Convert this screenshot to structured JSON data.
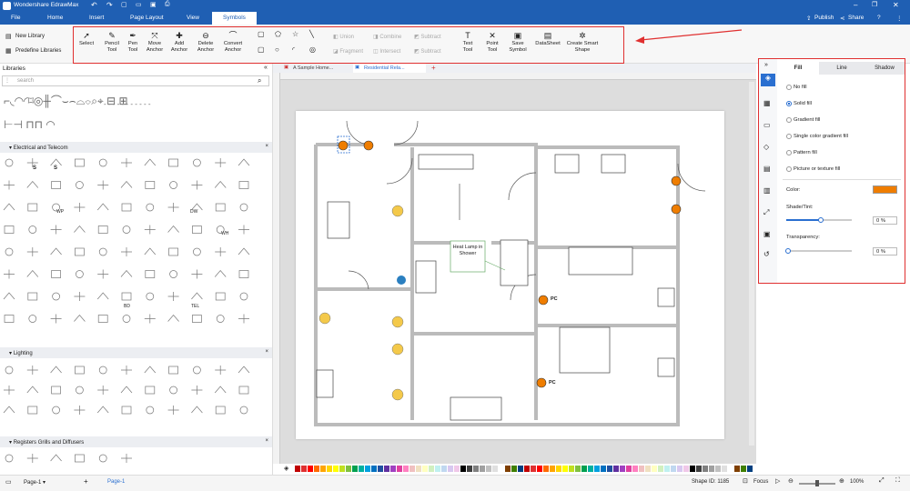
{
  "app": {
    "title": "Wondershare EdrawMax"
  },
  "menu": {
    "items": [
      "File",
      "Home",
      "Insert",
      "Page Layout",
      "View",
      "Symbols"
    ],
    "active": "Symbols"
  },
  "topright": {
    "publish": "Publish",
    "share": "Share"
  },
  "ribbon": {
    "select": "Select",
    "pencil": "Pencil Tool",
    "pen": "Pen Tool",
    "move_anchor": "Move Anchor",
    "add_anchor": "Add Anchor",
    "delete_anchor": "Delete Anchor",
    "convert_anchor": "Convert Anchor",
    "union": "Union",
    "combine": "Combine",
    "subtract": "Subtract",
    "fragment": "Fragment",
    "intersect": "Intersect",
    "subtract2": "Subtract",
    "text_tool": "Text Tool",
    "point_tool": "Point Tool",
    "save_symbol": "Save Symbol",
    "datasheet": "DataSheet",
    "create_smart": "Create Smart Shape"
  },
  "library": {
    "new_library": "New Library",
    "predefine": "Predefine Libraries",
    "title": "Libraries",
    "search_placeholder": "search",
    "sections": [
      "Electrical and Telecom",
      "Lighting",
      "Registers Grills and Diffusers"
    ],
    "sym_labels": [
      "S",
      "S",
      "WP",
      "DW",
      "WH",
      "BD",
      "TEL"
    ]
  },
  "tabs": {
    "tab1": "A Sample Home...",
    "tab2": "Residential Rela..."
  },
  "canvas": {
    "callout": "Heat Lamp in Shower",
    "pc1": "PC",
    "pc2": "PC"
  },
  "panel": {
    "tabs": [
      "Fill",
      "Line",
      "Shadow"
    ],
    "options": [
      "No fill",
      "Solid fill",
      "Gradient fill",
      "Single color gradient fill",
      "Pattern fill",
      "Picture or texture fill"
    ],
    "selected": "Solid fill",
    "color_label": "Color:",
    "fill_color": "#ef7d00",
    "shade_label": "Shade/Tint:",
    "shade_value": "0 %",
    "trans_label": "Transparency:",
    "trans_value": "0 %"
  },
  "status": {
    "page_select": "Page-1",
    "page_tab": "Page-1",
    "shape_id": "Shape ID: 1185",
    "focus": "Focus",
    "zoom": "100%"
  }
}
